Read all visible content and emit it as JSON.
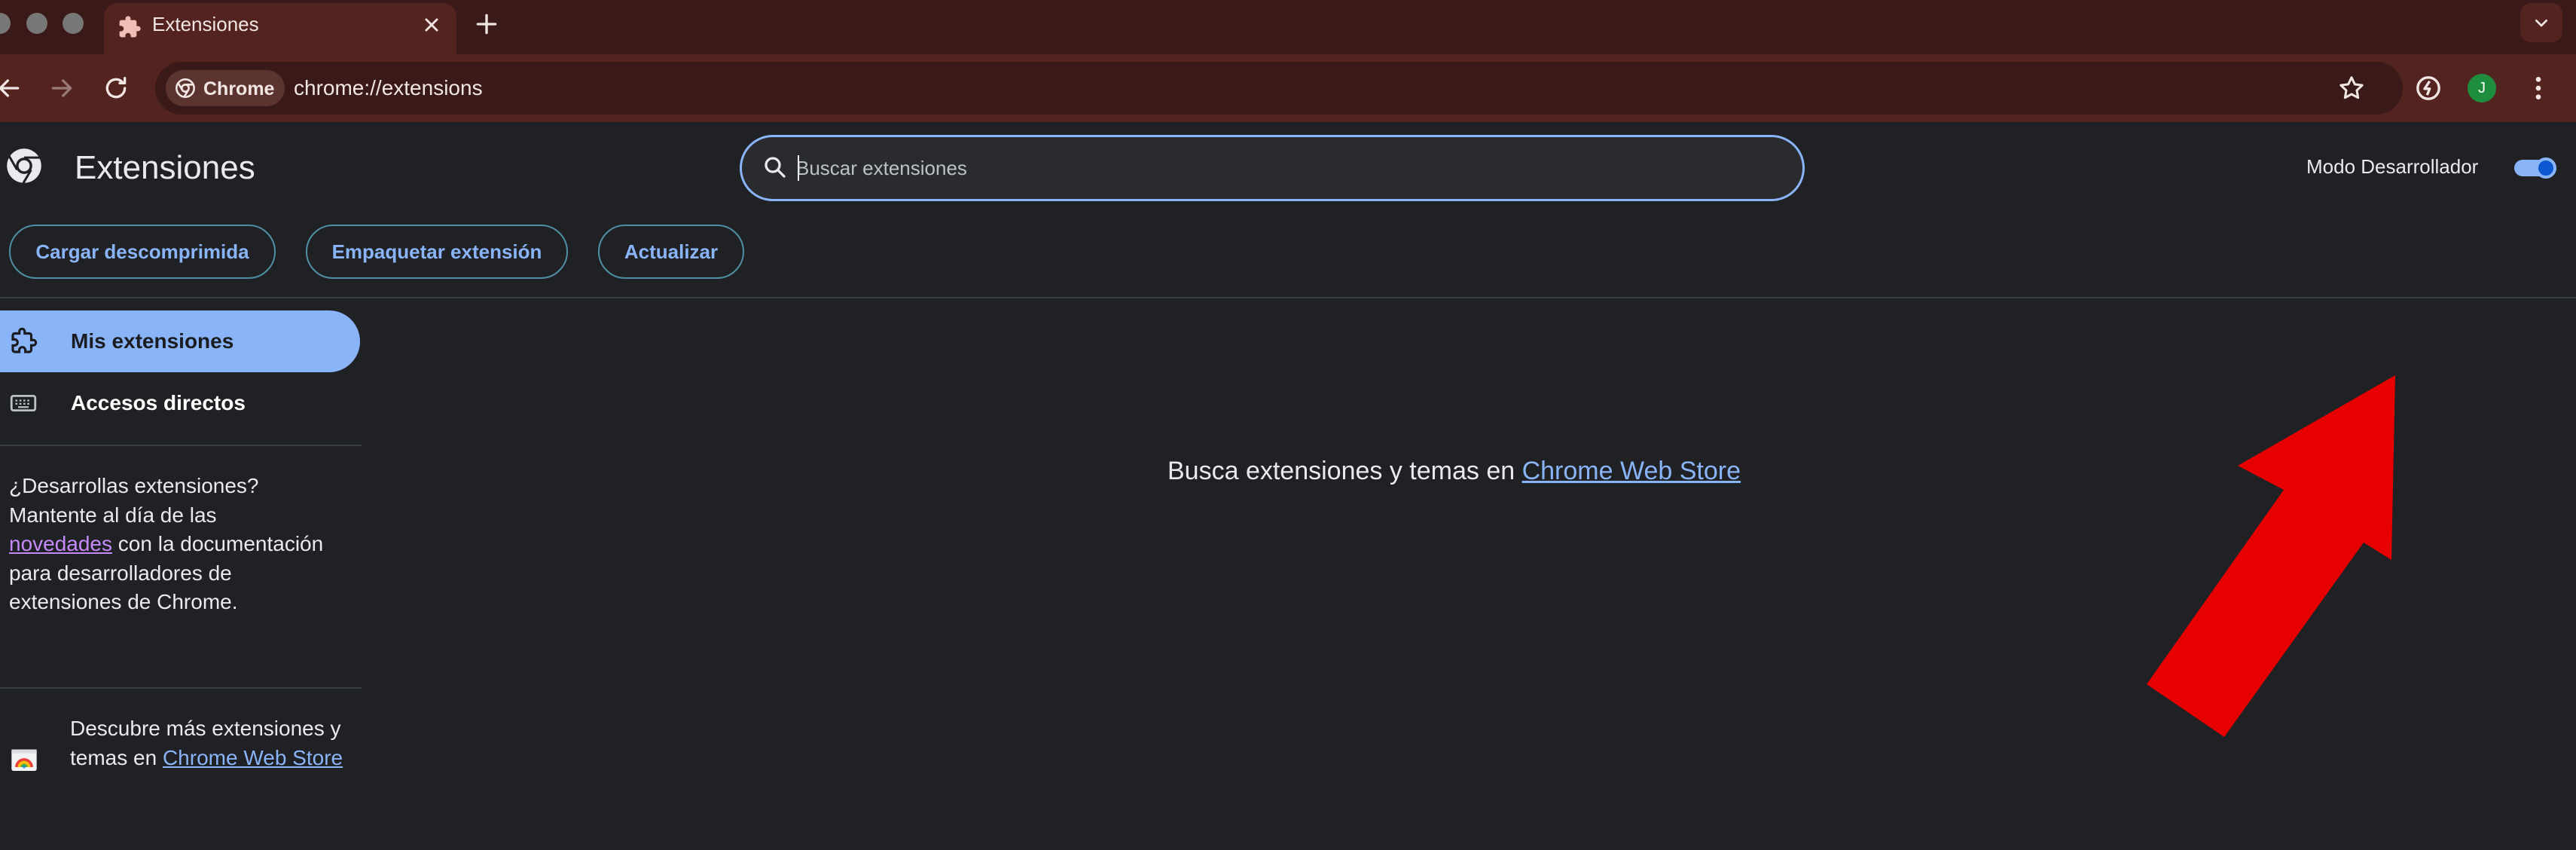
{
  "tab": {
    "title": "Extensiones"
  },
  "toolbar": {
    "chip_label": "Chrome",
    "url": "chrome://extensions",
    "avatar_letter": "J"
  },
  "header": {
    "title": "Extensiones",
    "search_placeholder": "Buscar extensiones",
    "devmode_label": "Modo Desarrollador",
    "devmode_enabled": true
  },
  "actions": {
    "load_unpacked": "Cargar descomprimida",
    "pack": "Empaquetar extensión",
    "update": "Actualizar"
  },
  "sidebar": {
    "items": [
      {
        "label": "Mis extensiones",
        "icon": "extension-icon",
        "active": true
      },
      {
        "label": "Accesos directos",
        "icon": "keyboard-icon",
        "active": false
      }
    ],
    "dev_text_1": "¿Desarrollas extensiones? Mantente al día de las ",
    "dev_link": "novedades",
    "dev_text_2": " con la documentación para desarrolladores de extensiones de Chrome.",
    "store_text": "Descubre más extensiones y temas en ",
    "store_link": "Chrome Web Store"
  },
  "main": {
    "message": "Busca extensiones y temas en ",
    "store_link": "Chrome Web Store"
  },
  "colors": {
    "accent": "#8ab4f8",
    "frame": "#52231f",
    "frame_dark": "#3a1a18",
    "background": "#202124",
    "annotation_arrow": "#e60000"
  }
}
